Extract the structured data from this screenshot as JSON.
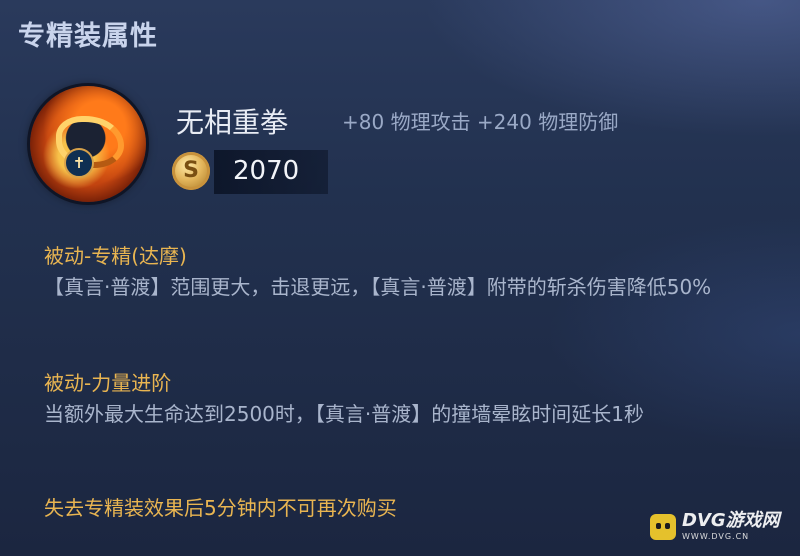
{
  "panel": {
    "title": "专精装属性"
  },
  "item": {
    "icon": "twisted-flame-relic-icon",
    "badge_glyph": "✝",
    "name": "无相重拳",
    "stats": "+80 物理攻击 +240 物理防御",
    "price_icon": "gold-coin-icon",
    "price": "2070"
  },
  "passives": [
    {
      "title": "被动-专精(达摩)",
      "description": "【真言·普渡】范围更大，击退更远，【真言·普渡】附带的斩杀伤害降低50%"
    },
    {
      "title": "被动-力量进阶",
      "description": "当额外最大生命达到2500时，【真言·普渡】的撞墙晕眩时间延长1秒"
    }
  ],
  "footer_note": "失去专精装效果后5分钟内不可再次购买",
  "watermark": {
    "brand": "DVG游戏网",
    "url": "WWW.DVG.CN"
  },
  "colors": {
    "accent_gold": "#e9b551",
    "text_primary": "#e8ecf4",
    "text_secondary": "#a9b5cc",
    "background": "#22314f"
  }
}
